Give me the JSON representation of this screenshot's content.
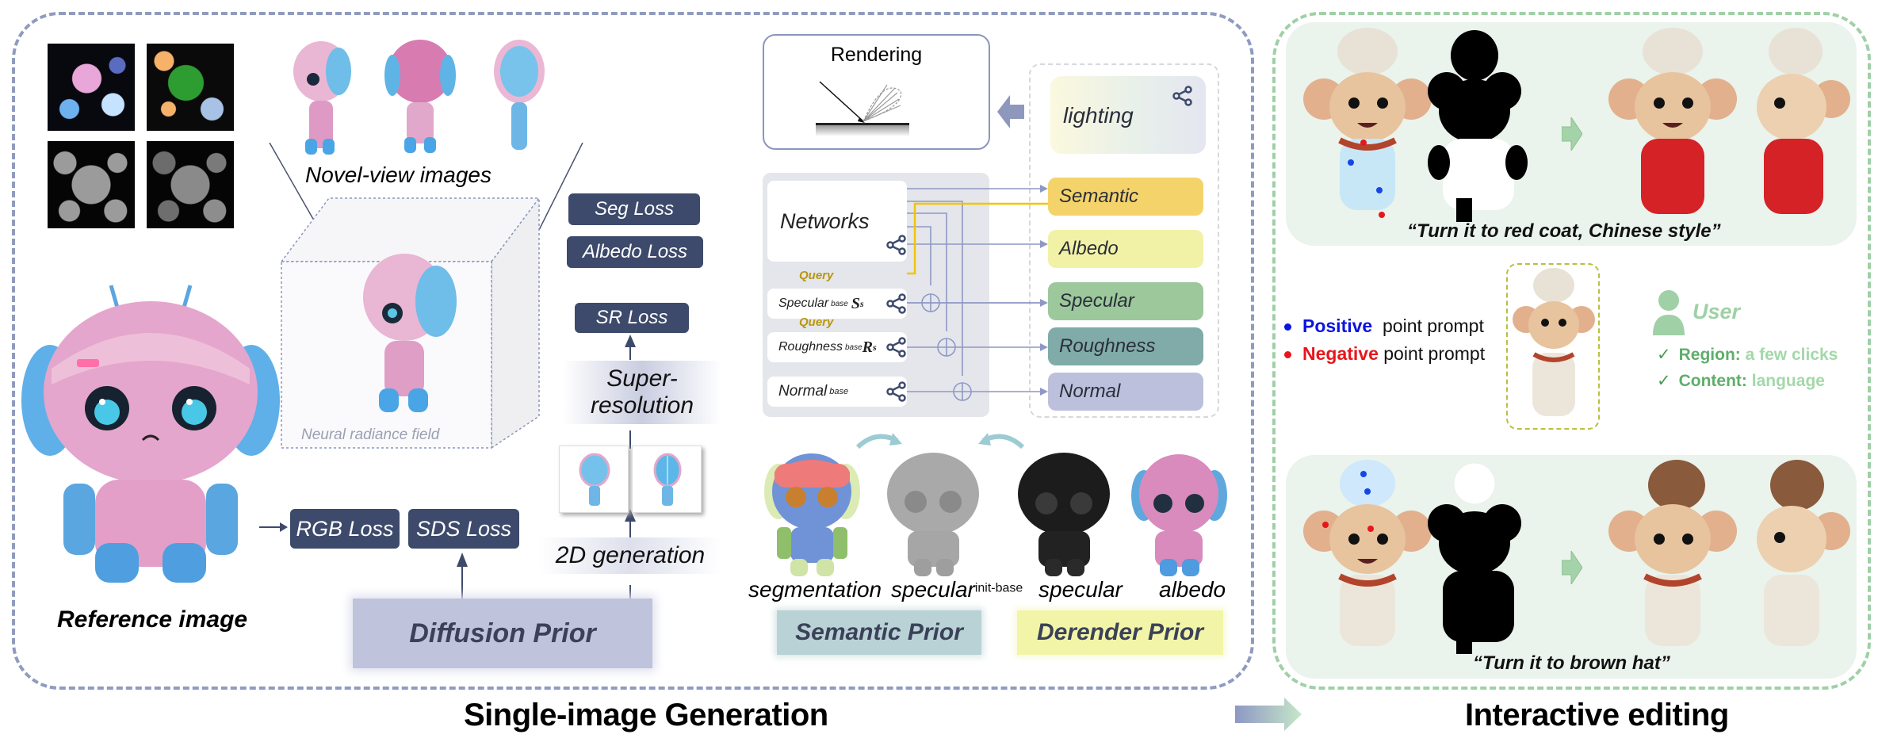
{
  "single_image_generation": {
    "title": "Single-image Generation",
    "texture_maps": [
      "albedo-uv-map",
      "segmentation-uv-map",
      "roughness-uv-map",
      "specular-uv-map"
    ],
    "novel_view_label": "Novel-view images",
    "nerf_label": "Neural radiance field",
    "reference_label": "Reference image",
    "losses": {
      "seg": "Seg Loss",
      "albedo": "Albedo Loss",
      "sr": "SR Loss",
      "rgb": "RGB Loss",
      "sds": "SDS Loss"
    },
    "super_resolution": [
      "Super-",
      "resolution"
    ],
    "generation_2d": "2D generation",
    "diffusion_prior": "Diffusion Prior",
    "rendering": {
      "title": "Rendering"
    },
    "lighting": "lighting",
    "networks": {
      "title": "Networks",
      "query_label": "Query",
      "rows": [
        {
          "name": "Specular",
          "sup": "base",
          "symbol": "S",
          "sub": "s"
        },
        {
          "name": "Roughness",
          "sup": "base",
          "symbol": "R",
          "sub": "s"
        },
        {
          "name": "Normal",
          "sup": "base",
          "symbol": "",
          "sub": ""
        }
      ]
    },
    "attributes": [
      {
        "label": "Semantic",
        "color": "#f4d36a"
      },
      {
        "label": "Albedo",
        "color": "#f1f2a6"
      },
      {
        "label": "Specular",
        "color": "#9cc89c"
      },
      {
        "label": "Roughness",
        "color": "#80aba8"
      },
      {
        "label": "Normal",
        "color": "#bcc0dc"
      }
    ],
    "prior_images": [
      {
        "label": "segmentation",
        "sup": ""
      },
      {
        "label": "specular",
        "sup": "init-base"
      },
      {
        "label": "specular",
        "sup": ""
      },
      {
        "label": "albedo",
        "sup": ""
      }
    ],
    "semantic_prior": "Semantic Prior",
    "derender_prior": "Derender Prior"
  },
  "interactive_editing": {
    "title": "Interactive editing",
    "example1_prompt": "“Turn it to red coat, Chinese style”",
    "example2_prompt": "“Turn it to brown hat”",
    "legend": {
      "positive_word": "Positive",
      "positive_rest": "point prompt",
      "negative_word": "Negative",
      "negative_rest": "point prompt",
      "positive_color": "#0a14e0",
      "negative_color": "#e8161a"
    },
    "user": {
      "label": "User",
      "region_key": "Region:",
      "region_value": "a few clicks",
      "content_key": "Content:",
      "content_value": "language",
      "check": "✓"
    }
  }
}
